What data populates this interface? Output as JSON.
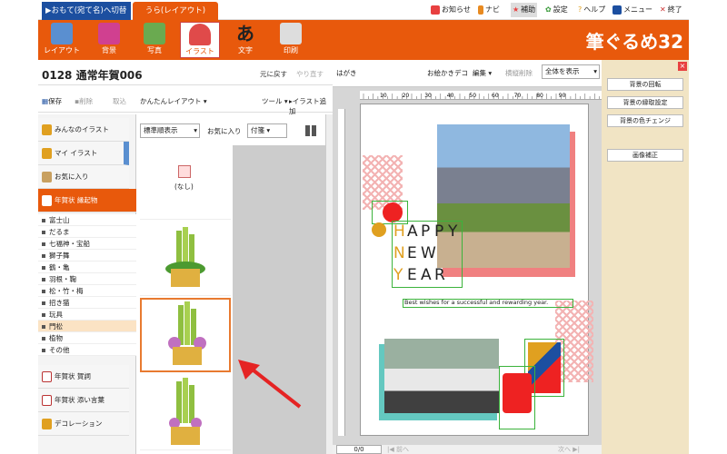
{
  "topbar": {
    "tab_front": "▶おもて(宛て名)へ切替",
    "tab_back": "うら(レイアウト)",
    "menu": [
      {
        "icon": "notice-icon",
        "label": "お知らせ"
      },
      {
        "icon": "navi-icon",
        "label": "ナビ"
      },
      {
        "icon": "star-icon",
        "label": "補助"
      },
      {
        "icon": "gear-icon",
        "label": "設定"
      },
      {
        "icon": "help-icon",
        "label": "ヘルプ"
      },
      {
        "icon": "menu-icon",
        "label": "メニュー"
      },
      {
        "icon": "close-icon",
        "label": "終了"
      }
    ]
  },
  "ribbon": {
    "buttons": [
      "レイアウト",
      "背景",
      "写真",
      "イラスト",
      "文字",
      "印刷"
    ],
    "logo": "筆ぐるめ32"
  },
  "doc": {
    "title": "0128 通常年賀006",
    "undo": "元に戻す",
    "redo": "やり直す"
  },
  "toolrow": {
    "save": "保存",
    "delete": "削除",
    "import": "取込",
    "easy_layout": "かんたんレイアウト",
    "tools": "ツール",
    "add_illust": "イラスト追加"
  },
  "nav": {
    "items": [
      "みんなのイラスト",
      "マイ イラスト",
      "お気に入り",
      "年賀状 縁起物"
    ],
    "sub": [
      "富士山",
      "だるま",
      "七福神・宝船",
      "獅子舞",
      "鶴・亀",
      "羽根・鞠",
      "松・竹・梅",
      "招き猫",
      "玩具",
      "門松",
      "植物",
      "その他"
    ],
    "items2": [
      "年賀状 賀詞",
      "年賀状 添い言葉",
      "デコレーション"
    ]
  },
  "sort": {
    "order": "標準順表示",
    "fav": "お気に入り",
    "fav_val": "付箋"
  },
  "images": {
    "none": "(なし)"
  },
  "canvas": {
    "paper": "はがき",
    "deco": "お絵かきデコ",
    "edit": "編集",
    "bulk": "横縦削除",
    "view": "全体を表示",
    "page": "0/0",
    "prev": "前へ",
    "next": "次へ"
  },
  "card": {
    "happy": [
      "H",
      "A",
      "P",
      "P",
      "Y"
    ],
    "new": [
      "N",
      "E",
      "W"
    ],
    "year": [
      "Y",
      "E",
      "A",
      "R"
    ],
    "greeting": "Best wishes for a successful and rewarding year."
  },
  "ruler": [
    "10",
    "20",
    "30",
    "40",
    "50",
    "60",
    "70",
    "80",
    "90"
  ],
  "right": {
    "buttons": [
      "背景の回転",
      "背景の縁取設定",
      "背景の色チェンジ",
      "画像補正"
    ]
  },
  "colors": {
    "accent": "#e8590c",
    "blue": "#1c4fa0",
    "sel": "#e87a30"
  }
}
